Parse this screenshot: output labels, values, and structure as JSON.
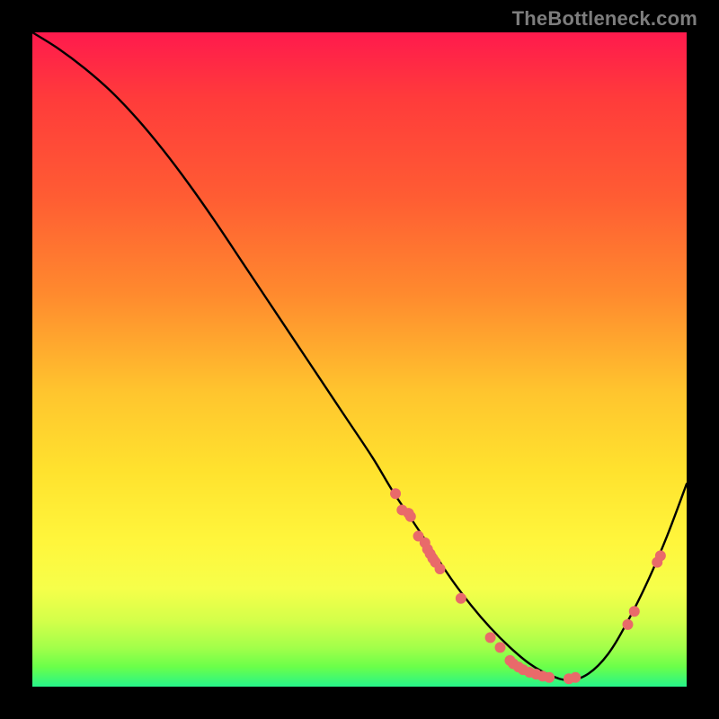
{
  "watermark": "TheBottleneck.com",
  "colors": {
    "curve": "#000000",
    "dot": "#e96a6a",
    "background": "#000000",
    "gradient_top": "#ff1a4d",
    "gradient_bottom": "#26f48a"
  },
  "chart_data": {
    "type": "line",
    "title": "",
    "xlabel": "",
    "ylabel": "",
    "xlim": [
      0,
      100
    ],
    "ylim": [
      0,
      100
    ],
    "series": [
      {
        "name": "bottleneck-curve",
        "x": [
          0,
          4,
          8,
          12,
          16,
          20,
          24,
          28,
          32,
          36,
          40,
          44,
          48,
          52,
          55,
          58,
          61,
          64,
          67,
          70,
          73,
          76,
          79,
          82,
          85,
          88,
          91,
          94,
          97,
          100
        ],
        "y": [
          100,
          97.5,
          94.5,
          91,
          86.8,
          82,
          76.7,
          71,
          65,
          59,
          53,
          47,
          41,
          35,
          30,
          25.5,
          21,
          16.5,
          12.5,
          9,
          6,
          3.5,
          1.8,
          1,
          2,
          5,
          10,
          16,
          23,
          31
        ]
      }
    ],
    "scatter_points": [
      {
        "x": 55.5,
        "y": 29.5
      },
      {
        "x": 56.5,
        "y": 27.0
      },
      {
        "x": 57.5,
        "y": 26.5
      },
      {
        "x": 57.8,
        "y": 26.0
      },
      {
        "x": 59.0,
        "y": 23.0
      },
      {
        "x": 60.0,
        "y": 22.0
      },
      {
        "x": 60.4,
        "y": 21.0
      },
      {
        "x": 60.8,
        "y": 20.3
      },
      {
        "x": 61.2,
        "y": 19.6
      },
      {
        "x": 61.6,
        "y": 19.0
      },
      {
        "x": 62.3,
        "y": 18.0
      },
      {
        "x": 65.5,
        "y": 13.5
      },
      {
        "x": 70.0,
        "y": 7.5
      },
      {
        "x": 71.5,
        "y": 6.0
      },
      {
        "x": 73.0,
        "y": 4.0
      },
      {
        "x": 73.5,
        "y": 3.5
      },
      {
        "x": 74.3,
        "y": 3.0
      },
      {
        "x": 75.0,
        "y": 2.6
      },
      {
        "x": 76.0,
        "y": 2.2
      },
      {
        "x": 77.0,
        "y": 1.9
      },
      {
        "x": 78.0,
        "y": 1.6
      },
      {
        "x": 79.0,
        "y": 1.4
      },
      {
        "x": 82.0,
        "y": 1.2
      },
      {
        "x": 83.0,
        "y": 1.4
      },
      {
        "x": 91.0,
        "y": 9.5
      },
      {
        "x": 92.0,
        "y": 11.5
      },
      {
        "x": 95.5,
        "y": 19.0
      },
      {
        "x": 96.0,
        "y": 20.0
      }
    ],
    "dot_radius_px": 6
  }
}
